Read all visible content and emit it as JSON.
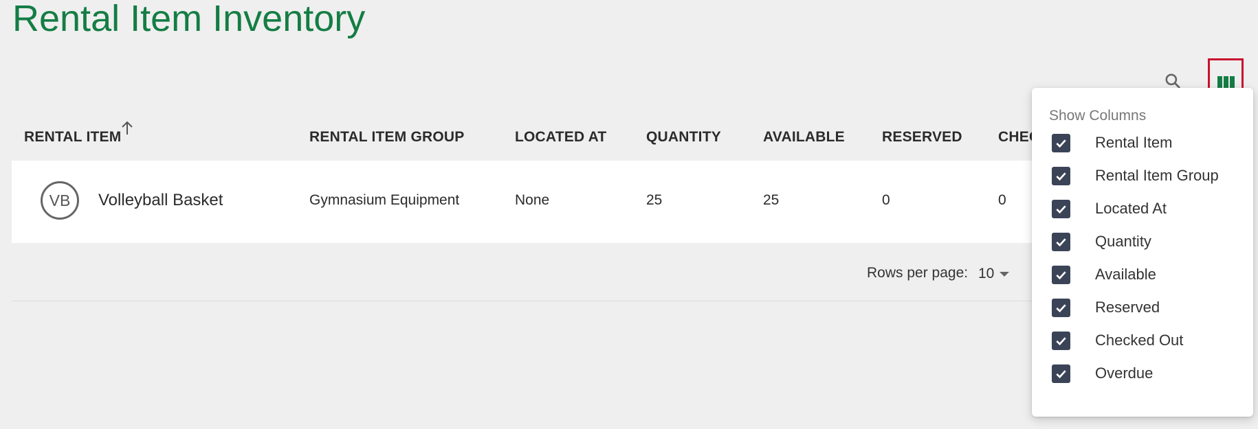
{
  "page": {
    "title": "Rental Item Inventory"
  },
  "colors": {
    "title": "#147d44",
    "accent": "#147d44",
    "highlight_border": "#c8102e",
    "checkbox": "#3b4457"
  },
  "toolbar": {
    "search_icon": "search-icon",
    "columns_icon": "view-columns-icon"
  },
  "table": {
    "headers": {
      "rental_item": "RENTAL ITEM",
      "rental_item_group": "RENTAL ITEM GROUP",
      "located_at": "LOCATED AT",
      "quantity": "QUANTITY",
      "available": "AVAILABLE",
      "reserved": "RESERVED",
      "checked_out_partial": "CHEC"
    },
    "sort": {
      "column": "rental_item",
      "direction": "ascending",
      "icon": "arrow-up-icon"
    },
    "rows": [
      {
        "avatar": "VB",
        "rental_item": "Volleyball Basket",
        "rental_item_group": "Gymnasium Equipment",
        "located_at": "None",
        "quantity": "25",
        "available": "25",
        "reserved": "0",
        "checked_out": "0"
      }
    ]
  },
  "pagination": {
    "rows_per_page_label": "Rows per page:",
    "rows_per_page_value": "10"
  },
  "show_columns": {
    "title": "Show Columns",
    "options": [
      {
        "label": "Rental Item",
        "checked": true
      },
      {
        "label": "Rental Item Group",
        "checked": true
      },
      {
        "label": "Located At",
        "checked": true
      },
      {
        "label": "Quantity",
        "checked": true
      },
      {
        "label": "Available",
        "checked": true
      },
      {
        "label": "Reserved",
        "checked": true
      },
      {
        "label": "Checked Out",
        "checked": true
      },
      {
        "label": "Overdue",
        "checked": true
      }
    ]
  }
}
